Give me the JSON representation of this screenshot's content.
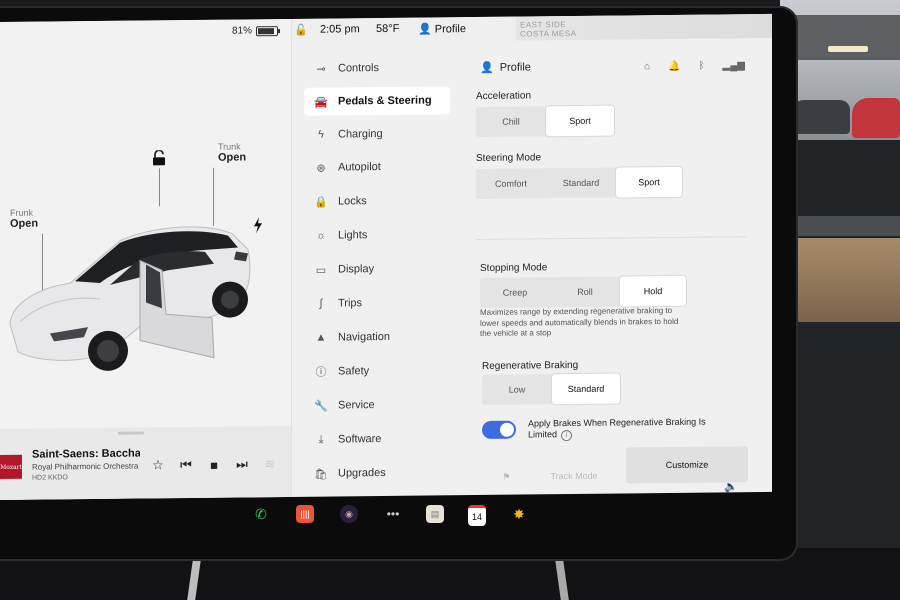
{
  "status": {
    "battery_pct": "81%",
    "time": "2:05 pm",
    "temperature": "58°F",
    "profile_label": "Profile",
    "map_label_line1": "EAST SIDE",
    "map_label_line2": "COSTA MESA"
  },
  "car": {
    "frunk_label": "Frunk",
    "frunk_state": "Open",
    "trunk_label": "Trunk",
    "trunk_state": "Open"
  },
  "media": {
    "title": "Saint-Saens: Bacchanale",
    "artist": "Royal Philharmonic Orchestra",
    "source": "HD2 KKDO",
    "album_text": "Mozart"
  },
  "menu": {
    "items": [
      {
        "label": "Controls",
        "icon": "toggle-icon"
      },
      {
        "label": "Pedals & Steering",
        "icon": "car-icon"
      },
      {
        "label": "Charging",
        "icon": "bolt-icon"
      },
      {
        "label": "Autopilot",
        "icon": "steering-wheel-icon"
      },
      {
        "label": "Locks",
        "icon": "lock-icon"
      },
      {
        "label": "Lights",
        "icon": "sun-icon"
      },
      {
        "label": "Display",
        "icon": "display-icon"
      },
      {
        "label": "Trips",
        "icon": "trips-icon"
      },
      {
        "label": "Navigation",
        "icon": "navigation-arrow-icon"
      },
      {
        "label": "Safety",
        "icon": "safety-icon"
      },
      {
        "label": "Service",
        "icon": "wrench-icon"
      },
      {
        "label": "Software",
        "icon": "download-icon"
      },
      {
        "label": "Upgrades",
        "icon": "bag-icon"
      }
    ],
    "active_index": 1
  },
  "panel": {
    "profile_label": "Profile",
    "acceleration": {
      "label": "Acceleration",
      "options": [
        "Chill",
        "Sport"
      ],
      "selected": "Sport"
    },
    "steering_mode": {
      "label": "Steering Mode",
      "options": [
        "Comfort",
        "Standard",
        "Sport"
      ],
      "selected": "Sport"
    },
    "stopping_mode": {
      "label": "Stopping Mode",
      "options": [
        "Creep",
        "Roll",
        "Hold"
      ],
      "selected": "Hold",
      "description": "Maximizes range by extending regenerative braking to lower speeds and automatically blends in brakes to hold the vehicle at a stop"
    },
    "regen_braking": {
      "label": "Regenerative Braking",
      "options": [
        "Low",
        "Standard"
      ],
      "selected": "Standard"
    },
    "apply_brakes": {
      "label": "Apply Brakes When Regenerative Braking Is Limited",
      "enabled": true
    },
    "track_mode_label": "Track Mode",
    "customize_label": "Customize"
  },
  "dock": {
    "calendar_day": "14"
  },
  "colors": {
    "toggle_on": "#3e6be0",
    "screen_bg": "#f0f0f0",
    "album_red": "#b0182a"
  }
}
